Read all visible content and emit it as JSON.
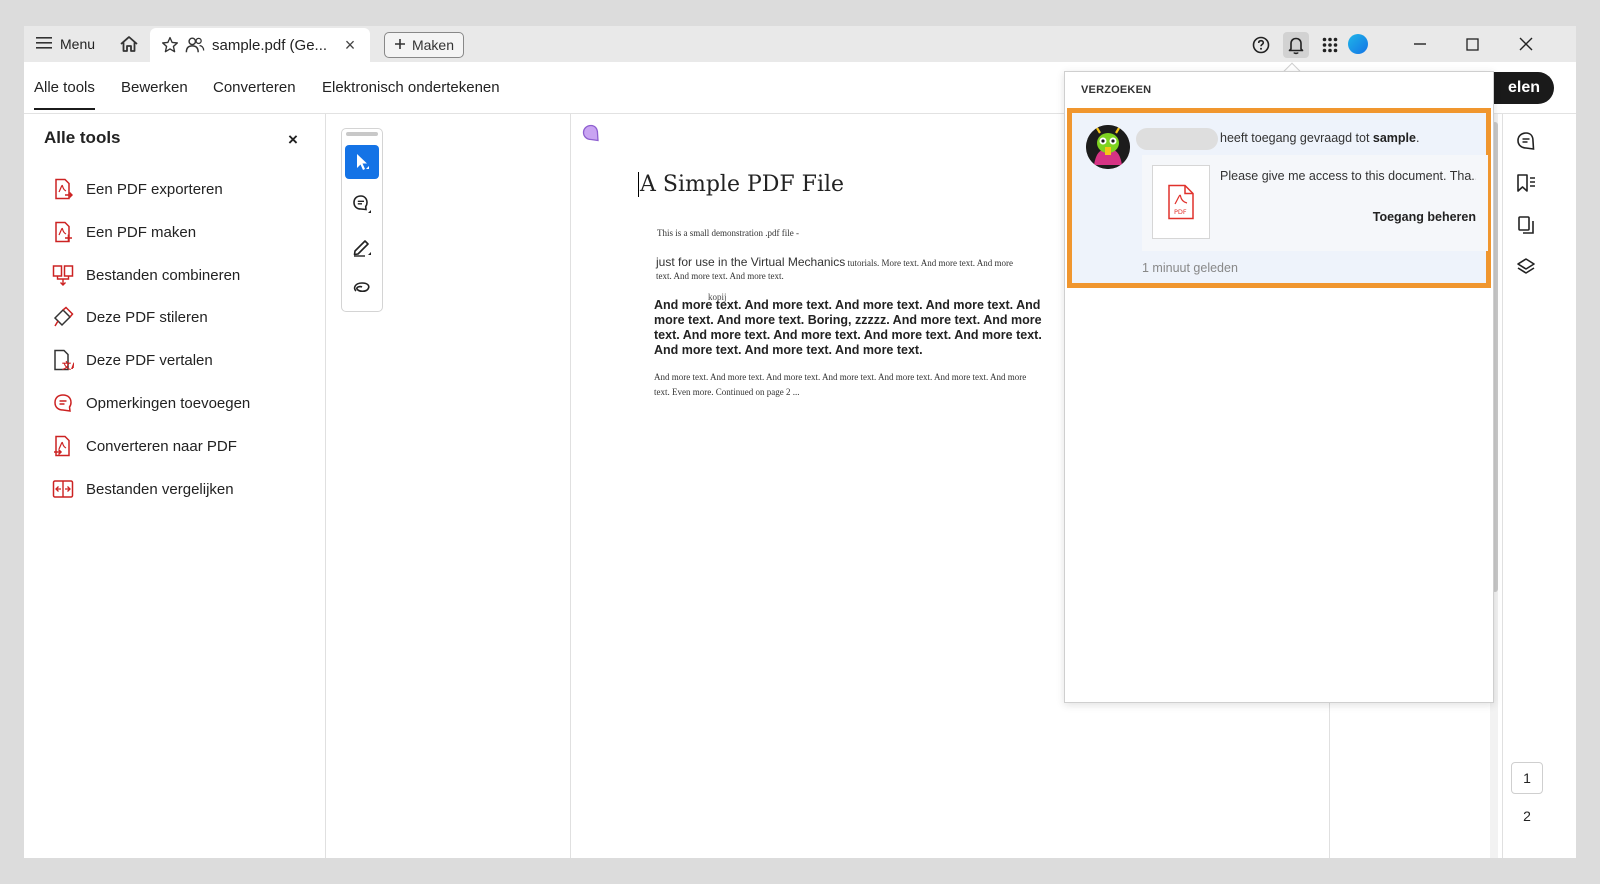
{
  "titlebar": {
    "menu_label": "Menu",
    "tab_title": "sample.pdf (Ge...",
    "tab_close": "×",
    "new_button_label": "Maken",
    "window_controls": {
      "minimize": "—",
      "maximize": "☐",
      "close": "✕"
    }
  },
  "tool_tabs": {
    "items": [
      "Alle tools",
      "Bewerken",
      "Converteren",
      "Elektronisch ondertekenen"
    ],
    "active": "Alle tools",
    "share_button_partial": "elen"
  },
  "left_panel": {
    "title": "Alle tools",
    "close": "×",
    "tools": [
      {
        "label": "Een PDF exporteren",
        "icon": "pdf-export-icon"
      },
      {
        "label": "Een PDF maken",
        "icon": "pdf-create-icon"
      },
      {
        "label": "Bestanden combineren",
        "icon": "combine-files-icon"
      },
      {
        "label": "Deze PDF stileren",
        "icon": "stylize-pdf-icon"
      },
      {
        "label": "Deze PDF vertalen",
        "icon": "translate-pdf-icon"
      },
      {
        "label": "Opmerkingen toevoegen",
        "icon": "comment-icon"
      },
      {
        "label": "Converteren naar PDF",
        "icon": "convert-to-pdf-icon"
      },
      {
        "label": "Bestanden vergelijken",
        "icon": "compare-files-icon"
      }
    ]
  },
  "document": {
    "title": "A Simple PDF File",
    "line1": "This is a small demonstration .pdf file -",
    "line2_sans": "just for use in the Virtual Mechanics",
    "line2_rest": " tutorials. More text. And more  text. And more text. And more text. And more text.",
    "bold_paragraph": "And more text. And more text. And more text. And more text. And more  text. And more text. Boring, zzzzz. And more text. And more text. And  more text. And more text. And more text. And more text. And more text.  And more text. And more text.",
    "last_paragraph": "And more text. And more text. And more text. And more text. And more  text. And more text. And more text. Even more. Continued on page 2 ...",
    "stamp": "kopij"
  },
  "notifications": {
    "header": "VERZOEKEN",
    "items": [
      {
        "text": "heeft toegang gevraagd tot ",
        "file": "sample",
        "suffix": ".",
        "message": "Please give me access to this document. Tha...",
        "action": "Toegang beheren",
        "time": "1 minuut geleden",
        "thumb_label": "PDF"
      }
    ],
    "highlight_color": "#f0962e"
  },
  "page_nav": {
    "pages": [
      "1",
      "2"
    ],
    "current": "1"
  },
  "colors": {
    "accent": "#1473e6",
    "pdf_red": "#e0312b",
    "highlight": "#f0962e"
  }
}
